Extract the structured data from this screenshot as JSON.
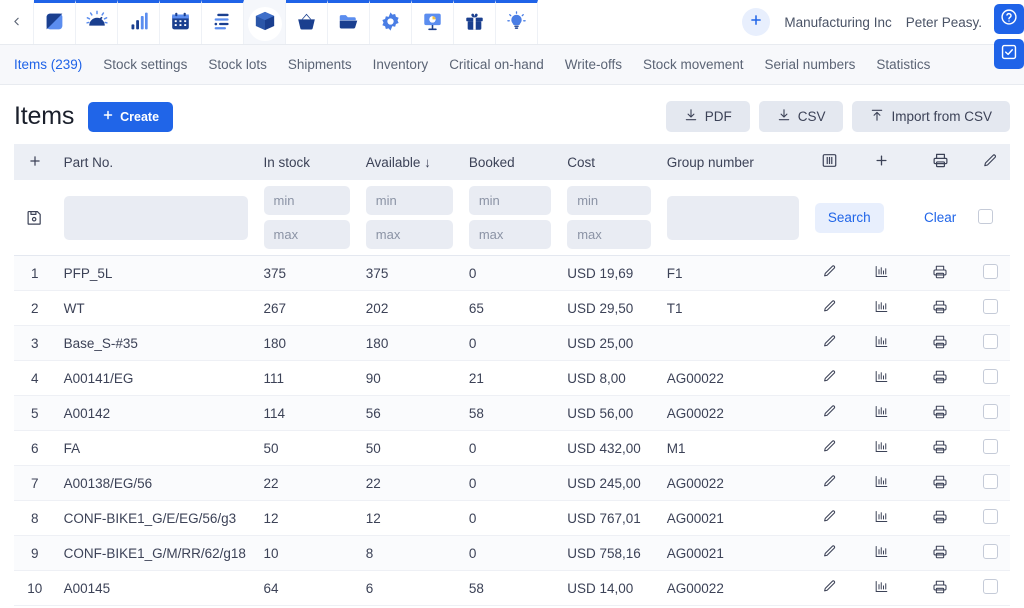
{
  "topbar": {
    "back_icon": "chevron-left-icon",
    "nav_icons": [
      {
        "name": "dashboard-split-square-icon"
      },
      {
        "name": "gauge-speedometer-icon"
      },
      {
        "name": "bar-chart-icon"
      },
      {
        "name": "calendar-icon"
      },
      {
        "name": "tasks-list-icon"
      },
      {
        "name": "stock-box-icon",
        "active": true
      },
      {
        "name": "shopping-basket-icon"
      },
      {
        "name": "folder-open-icon"
      },
      {
        "name": "gear-settings-icon"
      },
      {
        "name": "presentation-chart-icon"
      },
      {
        "name": "gift-icon"
      },
      {
        "name": "lightbulb-icon"
      }
    ],
    "add_label": "+",
    "company": "Manufacturing Inc",
    "user": "Peter Peasy.",
    "logout_icon": "logout-icon",
    "float_buttons": [
      {
        "name": "help-question-icon"
      },
      {
        "name": "checkbox-check-icon"
      }
    ]
  },
  "tabs": [
    {
      "label": "Items (239)",
      "active": true
    },
    {
      "label": "Stock settings",
      "active": false
    },
    {
      "label": "Stock lots",
      "active": false
    },
    {
      "label": "Shipments",
      "active": false
    },
    {
      "label": "Inventory",
      "active": false
    },
    {
      "label": "Critical on-hand",
      "active": false
    },
    {
      "label": "Write-offs",
      "active": false
    },
    {
      "label": "Stock movement",
      "active": false
    },
    {
      "label": "Serial numbers",
      "active": false
    },
    {
      "label": "Statistics",
      "active": false
    }
  ],
  "page": {
    "title": "Items",
    "create_label": "Create",
    "pdf_label": "PDF",
    "csv_label": "CSV",
    "import_label": "Import from CSV"
  },
  "table": {
    "headers": {
      "add": "+",
      "part_no": "Part No.",
      "in_stock": "In stock",
      "available": "Available",
      "available_sort": "↓",
      "booked": "Booked",
      "cost": "Cost",
      "group_number": "Group number",
      "columns_icon": "columns-config-icon",
      "add_icon": "plus-icon",
      "print_icon": "printer-icon",
      "edit_icon": "pencil-icon"
    },
    "filters": {
      "save_icon": "save-filter-icon",
      "part_no_value": "",
      "in_stock_min": "min",
      "in_stock_max": "max",
      "available_min": "min",
      "available_max": "max",
      "booked_min": "min",
      "booked_max": "max",
      "cost_min": "min",
      "cost_max": "max",
      "group_value": "",
      "search_label": "Search",
      "clear_label": "Clear"
    },
    "rows": [
      {
        "idx": "1",
        "part": "PFP_5L",
        "stock": "375",
        "available": "375",
        "booked": "0",
        "cost": "USD 19,69",
        "group": "F1"
      },
      {
        "idx": "2",
        "part": "WT",
        "stock": "267",
        "available": "202",
        "booked": "65",
        "cost": "USD 29,50",
        "group": "T1"
      },
      {
        "idx": "3",
        "part": "Base_S-#35",
        "stock": "180",
        "available": "180",
        "booked": "0",
        "cost": "USD 25,00",
        "group": ""
      },
      {
        "idx": "4",
        "part": "A00141/EG",
        "stock": "111",
        "available": "90",
        "booked": "21",
        "cost": "USD 8,00",
        "group": "AG00022"
      },
      {
        "idx": "5",
        "part": "A00142",
        "stock": "114",
        "available": "56",
        "booked": "58",
        "cost": "USD 56,00",
        "group": "AG00022"
      },
      {
        "idx": "6",
        "part": "FA",
        "stock": "50",
        "available": "50",
        "booked": "0",
        "cost": "USD 432,00",
        "group": "M1"
      },
      {
        "idx": "7",
        "part": "A00138/EG/56",
        "stock": "22",
        "available": "22",
        "booked": "0",
        "cost": "USD 245,00",
        "group": "AG00022"
      },
      {
        "idx": "8",
        "part": "CONF-BIKE1_G/E/EG/56/g3",
        "stock": "12",
        "available": "12",
        "booked": "0",
        "cost": "USD 767,01",
        "group": "AG00021"
      },
      {
        "idx": "9",
        "part": "CONF-BIKE1_G/M/RR/62/g18",
        "stock": "10",
        "available": "8",
        "booked": "0",
        "cost": "USD 758,16",
        "group": "AG00021"
      },
      {
        "idx": "10",
        "part": "A00145",
        "stock": "64",
        "available": "6",
        "booked": "58",
        "cost": "USD 14,00",
        "group": "AG00022"
      }
    ],
    "row_icons": {
      "edit": "pencil-icon",
      "stats": "bar-chart-icon",
      "print": "printer-icon",
      "select": "row-checkbox"
    }
  },
  "colors": {
    "accent": "#2065e8",
    "icon_dark": "#1a3f8f",
    "icon_light": "#5b8def",
    "header_bg": "#eceff5"
  }
}
